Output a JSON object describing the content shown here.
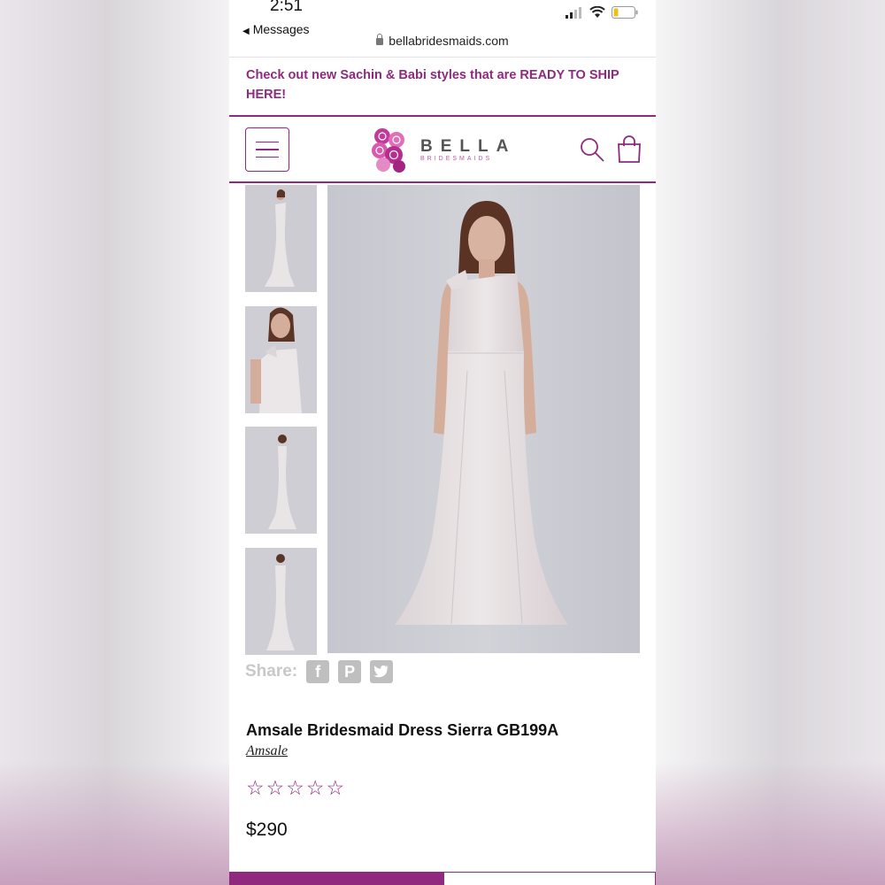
{
  "status_bar": {
    "time": "2:51",
    "back_label": "Messages",
    "url": "bellabridesmaids.com"
  },
  "promo": {
    "text": "Check out new Sachin & Babi styles that are READY TO SHIP HERE!"
  },
  "header": {
    "logo_title": "BELLA",
    "logo_subtitle": "BRIDESMAIDS"
  },
  "share": {
    "label": "Share:",
    "icons": [
      "facebook-icon",
      "pinterest-icon",
      "twitter-icon"
    ]
  },
  "product": {
    "title": "Amsale Bridesmaid Dress Sierra GB199A",
    "brand": "Amsale",
    "rating": 0,
    "price": "$290"
  },
  "colors": {
    "accent": "#8f2a7e"
  }
}
